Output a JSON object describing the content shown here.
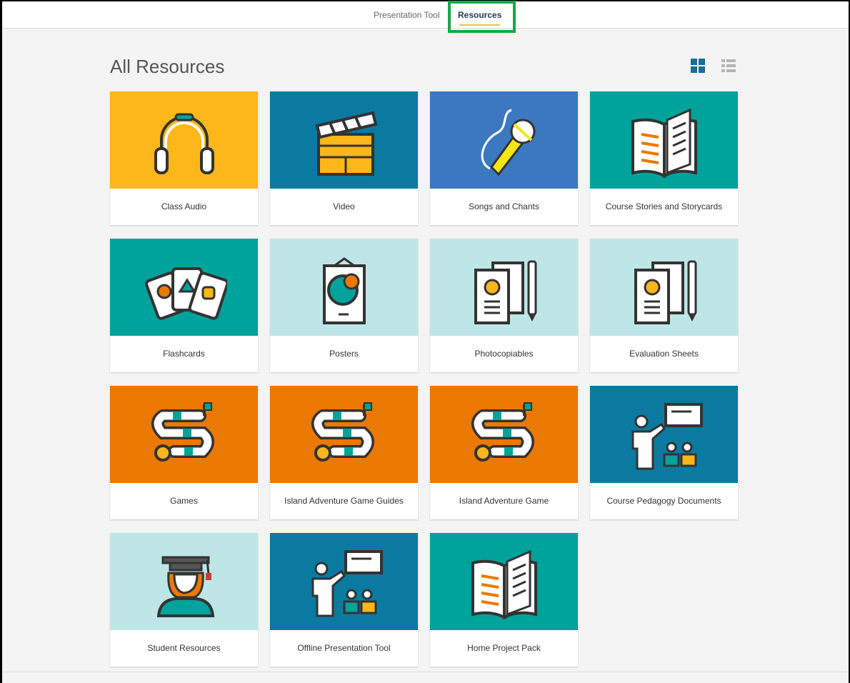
{
  "topbar": {
    "tabs": [
      {
        "label": "Presentation Tool"
      },
      {
        "label": "Resources"
      }
    ]
  },
  "page": {
    "title": "All Resources"
  },
  "view_toggles": {
    "grid_icon": "grid-view-icon",
    "list_icon": "list-view-icon",
    "active": "grid"
  },
  "colors": {
    "yellow": "#fdb71a",
    "dark_blue": "#0b7aa0",
    "blue": "#3b78c0",
    "teal": "#00a39b",
    "light_teal": "#bfe6e7",
    "orange": "#eb7800",
    "highlight_green": "#1aa64a"
  },
  "cards": [
    {
      "label": "Class Audio",
      "icon": "headphones-icon",
      "bg": "#fdb71a"
    },
    {
      "label": "Video",
      "icon": "clapperboard-icon",
      "bg": "#0b7aa0"
    },
    {
      "label": "Songs and Chants",
      "icon": "microphone-icon",
      "bg": "#3b78c0"
    },
    {
      "label": "Course Stories and Storycards",
      "icon": "open-book-icon",
      "bg": "#00a39b"
    },
    {
      "label": "Flashcards",
      "icon": "flashcards-icon",
      "bg": "#00a39b"
    },
    {
      "label": "Posters",
      "icon": "poster-icon",
      "bg": "#bfe6e7"
    },
    {
      "label": "Photocopiables",
      "icon": "worksheet-pencil-icon",
      "bg": "#bfe6e7"
    },
    {
      "label": "Evaluation Sheets",
      "icon": "worksheet-pencil-icon",
      "bg": "#bfe6e7"
    },
    {
      "label": "Games",
      "icon": "board-game-icon",
      "bg": "#eb7800"
    },
    {
      "label": "Island Adventure Game Guides",
      "icon": "board-game-icon",
      "bg": "#eb7800"
    },
    {
      "label": "Island Adventure Game",
      "icon": "board-game-icon",
      "bg": "#eb7800"
    },
    {
      "label": "Course Pedagogy Documents",
      "icon": "teacher-icon",
      "bg": "#0b7aa0"
    },
    {
      "label": "Student Resources",
      "icon": "graduate-icon",
      "bg": "#bfe6e7"
    },
    {
      "label": "Offline Presentation Tool",
      "icon": "teacher-icon",
      "bg": "#0b7aa0"
    },
    {
      "label": "Home Project Pack",
      "icon": "open-book-icon",
      "bg": "#00a39b"
    }
  ]
}
